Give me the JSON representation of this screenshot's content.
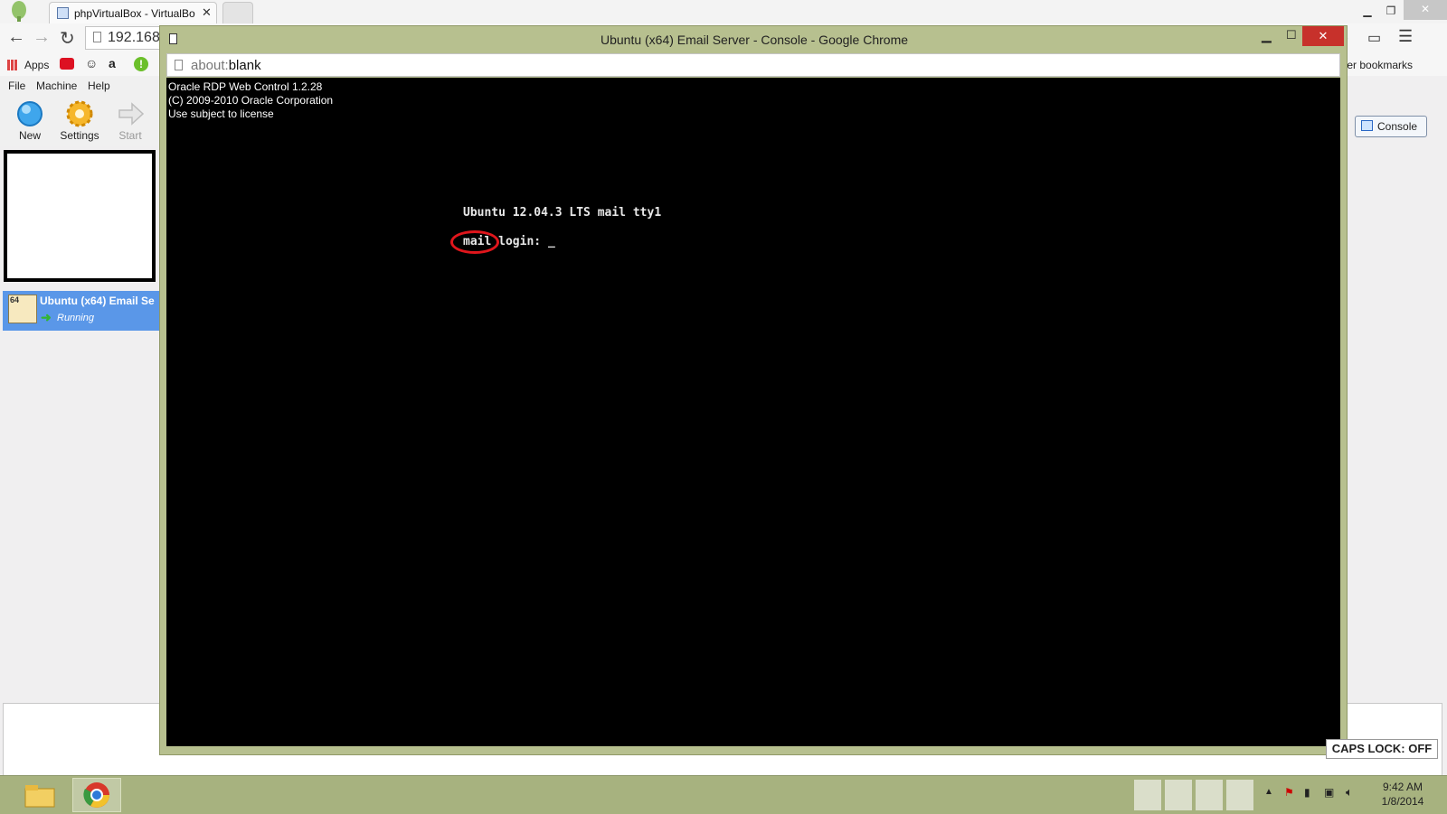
{
  "browser": {
    "tab_title": "phpVirtualBox - VirtualBo",
    "address": "192.168",
    "bookmarks": {
      "apps": "Apps",
      "other": "Other bookmarks"
    }
  },
  "vbox": {
    "menu": [
      "File",
      "Machine",
      "Help"
    ],
    "toolbar": {
      "new": "New",
      "settings": "Settings",
      "start": "Start"
    },
    "vm_name": "Ubuntu (x64) Email Se",
    "vm_state": "Running",
    "badge": "64",
    "console_tab": "Console"
  },
  "popup": {
    "title": "Ubuntu (x64) Email Server - Console - Google Chrome",
    "url_prefix": "about:",
    "url_rest": "blank"
  },
  "rdp": {
    "line1": "Oracle RDP Web Control 1.2.28",
    "line2": "(C) 2009-2010 Oracle Corporation",
    "line3": "Use subject to license"
  },
  "terminal": {
    "banner": "Ubuntu 12.04.3 LTS mail tty1",
    "host": "mail",
    "prompt": "login:",
    "cursor": "_"
  },
  "caps_lock": "CAPS LOCK: OFF",
  "clock": {
    "time": "9:42 AM",
    "date": "1/8/2014"
  },
  "colors": {
    "popup_frame": "#b7c08f",
    "highlight": "#e0161c",
    "selected_vm": "#5a97e8"
  }
}
